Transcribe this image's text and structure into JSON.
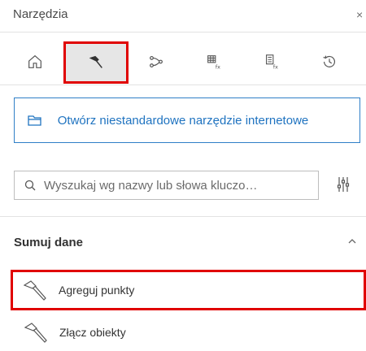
{
  "panel": {
    "title": "Narzędzia",
    "close_glyph": "×"
  },
  "tabs": [
    {
      "icon": "home-icon",
      "active": false
    },
    {
      "icon": "hammer-icon",
      "active": true
    },
    {
      "icon": "connect-nodes-icon",
      "active": false
    },
    {
      "icon": "table-function-icon",
      "active": false
    },
    {
      "icon": "list-function-icon",
      "active": false
    },
    {
      "icon": "history-icon",
      "active": false
    }
  ],
  "open_tool": {
    "label": "Otwórz niestandardowe narzędzie internetowe",
    "icon": "folder-icon"
  },
  "search": {
    "placeholder": "Wyszukaj wg nazwy lub słowa kluczo…",
    "value": ""
  },
  "section": {
    "title": "Sumuj dane",
    "expanded": true
  },
  "tools": [
    {
      "label": "Agreguj punkty",
      "icon": "hammer-icon",
      "highlighted": true
    },
    {
      "label": "Złącz obiekty",
      "icon": "hammer-icon",
      "highlighted": false
    }
  ],
  "colors": {
    "accent": "#1f73c0",
    "highlight": "#e00000",
    "active_tab": "#e6e6e6"
  }
}
